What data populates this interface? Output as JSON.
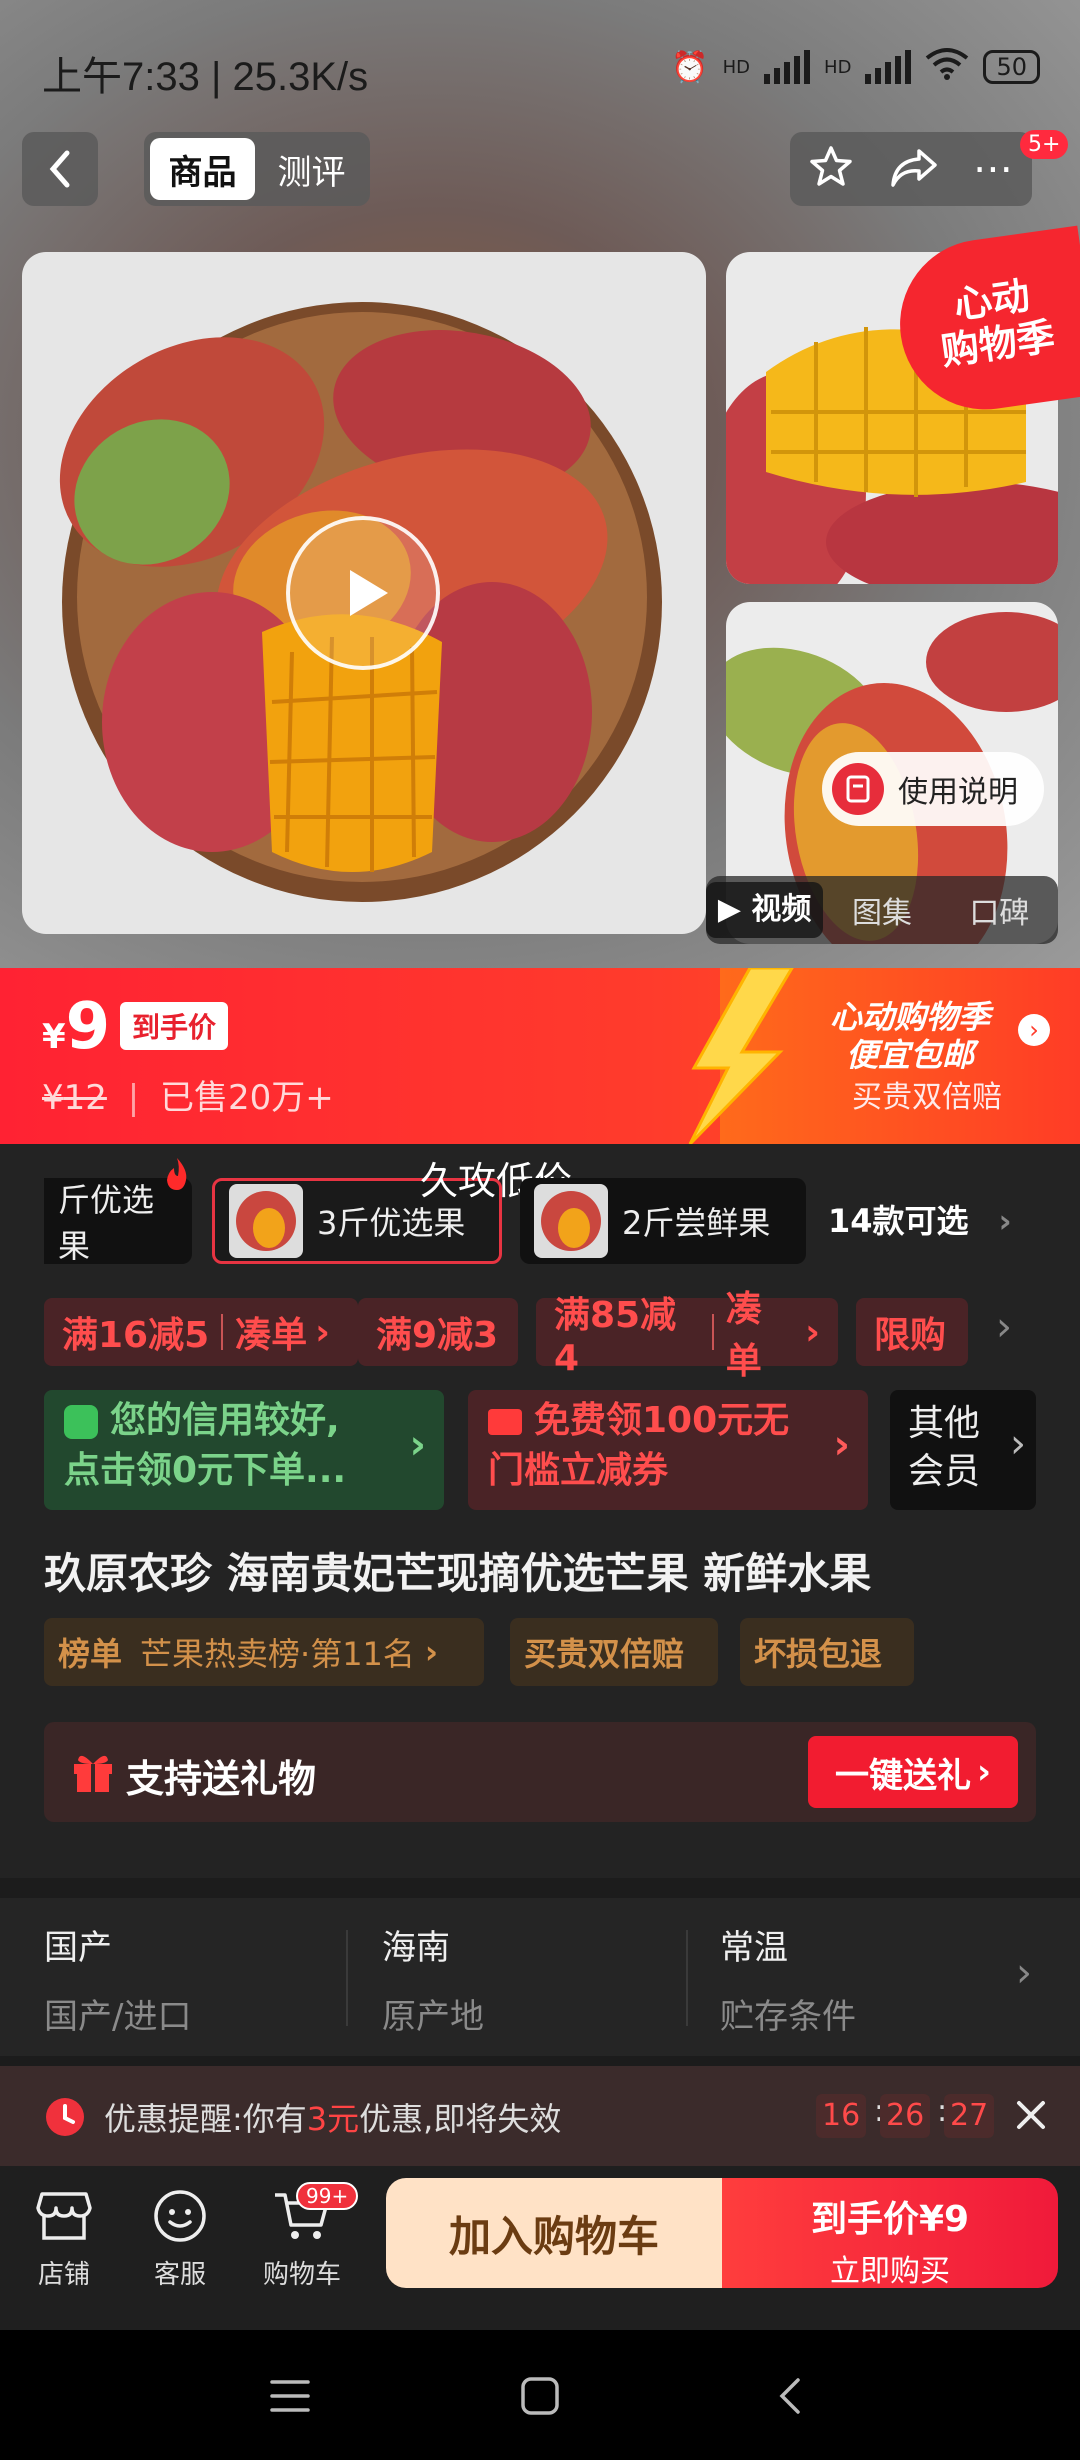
{
  "status_bar": {
    "time": "上午7:33 | 25.3K/s",
    "network1": "HD",
    "network2": "HD",
    "battery": "50"
  },
  "nav": {
    "tab_product": "商品",
    "tab_review": "测评",
    "message_badge": "5+"
  },
  "gallery": {
    "promo_badge": "心动\n购物季",
    "usage_label": "使用说明",
    "media_tabs": [
      "视频",
      "图集",
      "口碑"
    ]
  },
  "price": {
    "currency": "¥",
    "value": "9",
    "tag": "到手价",
    "original_currency": "¥",
    "original": "12",
    "sold": "已售20万+",
    "promo_title_1": "心动购物季",
    "promo_title_2": "便宜包邮",
    "promo_sub": "买贵双倍赔"
  },
  "specs": {
    "overlay_text": "久攻低价",
    "items": [
      "斤优选果",
      "3斤优选果",
      "2斤尝鲜果"
    ],
    "more": "14款可选"
  },
  "coupons": {
    "c1_a": "满16减5",
    "c1_b": "凑单",
    "c2": "满9减3",
    "c3_a": "满85减4",
    "c3_b": "凑单",
    "c4": "限购"
  },
  "offers": {
    "credit_1": "您的信用较好,",
    "credit_2": "点击领0元下单...",
    "free_1": "免费领100元无",
    "free_2": "门槛立减券",
    "vip_1": "其他",
    "vip_2": "会员"
  },
  "product": {
    "title": "玖原农珍 海南贵妃芒现摘优选芒果 新鲜水果",
    "rank_label": "榜单",
    "rank_text": "芒果热卖榜·第11名",
    "tag2": "买贵双倍赔",
    "tag3": "坏损包退"
  },
  "gift": {
    "label": "支持送礼物",
    "button": "一键送礼"
  },
  "attributes": [
    {
      "value": "国产",
      "key": "国产/进口"
    },
    {
      "value": "海南",
      "key": "原产地"
    },
    {
      "value": "常温",
      "key": "贮存条件"
    }
  ],
  "reminder": {
    "prefix": "优惠提醒:你有",
    "amount": "3元",
    "suffix": "优惠,即将失效",
    "h": "16",
    "m": "26",
    "s": "27"
  },
  "bottom": {
    "shop": "店铺",
    "service": "客服",
    "cart": "购物车",
    "cart_badge": "99+",
    "add_cart": "加入购物车",
    "buy_price": "到手价¥9",
    "buy_now": "立即购买"
  },
  "colors": {
    "accent_red": "#f21c30",
    "price_banner": "#ff2233",
    "credit_green": "#7bd38a"
  }
}
